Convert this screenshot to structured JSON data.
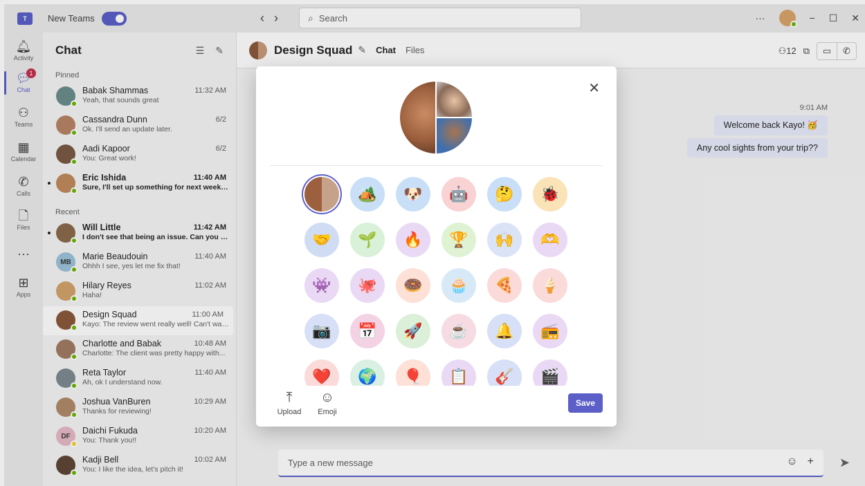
{
  "titlebar": {
    "app_label": "New Teams",
    "search_placeholder": "Search",
    "more": "···",
    "minimize": "−",
    "maximize": "☐",
    "close": "✕"
  },
  "rail": {
    "items": [
      {
        "label": "Activity",
        "icon": "bell-icon",
        "glyph": "🔔︎"
      },
      {
        "label": "Chat",
        "icon": "chat-icon",
        "glyph": "💬︎",
        "badge": "1"
      },
      {
        "label": "Teams",
        "icon": "teams-icon",
        "glyph": "⚇"
      },
      {
        "label": "Calendar",
        "icon": "calendar-icon",
        "glyph": "▦"
      },
      {
        "label": "Calls",
        "icon": "phone-icon",
        "glyph": "✆"
      },
      {
        "label": "Files",
        "icon": "file-icon",
        "glyph": "🗋︎"
      },
      {
        "label": "",
        "icon": "more-icon",
        "glyph": "···"
      },
      {
        "label": "Apps",
        "icon": "apps-icon",
        "glyph": "⊞"
      }
    ]
  },
  "chatlist": {
    "title": "Chat",
    "pinned_label": "Pinned",
    "recent_label": "Recent",
    "pinned": [
      {
        "name": "Babak Shammas",
        "preview": "Yeah, that sounds great",
        "time": "11:32 AM",
        "unread": false,
        "color": "#6b8e8c"
      },
      {
        "name": "Cassandra Dunn",
        "preview": "Ok. I'll send an update later.",
        "time": "6/2",
        "unread": false,
        "color": "#b88466"
      },
      {
        "name": "Aadi Kapoor",
        "preview": "You: Great work!",
        "time": "6/2",
        "unread": false,
        "color": "#7a5a44"
      },
      {
        "name": "Eric Ishida",
        "preview": "Sure, I'll set up something for next week t...",
        "time": "11:40 AM",
        "unread": true,
        "color": "#c08a5e"
      }
    ],
    "recent": [
      {
        "name": "Will Little",
        "preview": "I don't see that being an issue. Can you ta...",
        "time": "11:42 AM",
        "unread": true,
        "color": "#8a6a4c",
        "initials": ""
      },
      {
        "name": "Marie Beaudouin",
        "preview": "Ohhh I see, yes let me fix that!",
        "time": "11:40 AM",
        "unread": false,
        "color": "#9cc3d9",
        "initials": "MB"
      },
      {
        "name": "Hilary Reyes",
        "preview": "Haha!",
        "time": "11:02 AM",
        "unread": false,
        "color": "#d3a36b",
        "initials": ""
      },
      {
        "name": "Design Squad",
        "preview": "Kayo: The review went really well! Can't wai...",
        "time": "11:00 AM",
        "unread": false,
        "color": "#8a5a3c",
        "initials": "",
        "selected": true
      },
      {
        "name": "Charlotte and Babak",
        "preview": "Charlotte: The client was pretty happy with...",
        "time": "10:48 AM",
        "unread": false,
        "color": "#a07b62",
        "initials": ""
      },
      {
        "name": "Reta Taylor",
        "preview": "Ah, ok I understand now.",
        "time": "11:40 AM",
        "unread": false,
        "color": "#7d8a91",
        "initials": ""
      },
      {
        "name": "Joshua VanBuren",
        "preview": "Thanks for reviewing!",
        "time": "10:29 AM",
        "unread": false,
        "color": "#b08a6a",
        "initials": ""
      },
      {
        "name": "Daichi Fukuda",
        "preview": "You: Thank you!!",
        "time": "10:20 AM",
        "unread": false,
        "color": "#e7b9c6",
        "initials": "DF",
        "away": true
      },
      {
        "name": "Kadji Bell",
        "preview": "You: I like the idea, let's pitch it!",
        "time": "10:02 AM",
        "unread": false,
        "color": "#5e4636",
        "initials": ""
      }
    ]
  },
  "main": {
    "title": "Design Squad",
    "tabs": [
      "Chat",
      "Files"
    ],
    "participants": "12",
    "msg_time": "9:01 AM",
    "messages": [
      "Welcome back Kayo! 🥳",
      "Any cool sights from your trip??"
    ],
    "compose_placeholder": "Type a new message"
  },
  "dialog": {
    "close": "✕",
    "upload_label": "Upload",
    "emoji_label": "Emoji",
    "save_label": "Save",
    "options": [
      {
        "name": "group-photo-option",
        "emoji": "",
        "bg": "#f0f0f0"
      },
      {
        "name": "camping-tent-option",
        "emoji": "🏕️",
        "bg": "#c9dff7"
      },
      {
        "name": "dog-option",
        "emoji": "🐶",
        "bg": "#c9dff7"
      },
      {
        "name": "robot-option",
        "emoji": "🤖",
        "bg": "#f9d3d3"
      },
      {
        "name": "thinking-face-option",
        "emoji": "🤔",
        "bg": "#c9dff7"
      },
      {
        "name": "beetle-option",
        "emoji": "🐞",
        "bg": "#fbe3b8"
      },
      {
        "name": "handshake-option",
        "emoji": "🤝",
        "bg": "#cfdcf3"
      },
      {
        "name": "plant-hand-option",
        "emoji": "🌱",
        "bg": "#d9f0d9"
      },
      {
        "name": "flame-hands-option",
        "emoji": "🔥",
        "bg": "#ead9f5"
      },
      {
        "name": "trophy-option",
        "emoji": "🏆",
        "bg": "#dff3d4"
      },
      {
        "name": "hands-together-option",
        "emoji": "🙌",
        "bg": "#dbe3f7"
      },
      {
        "name": "heart-hands-option",
        "emoji": "🫶",
        "bg": "#ead9f5"
      },
      {
        "name": "purple-monster-option",
        "emoji": "👾",
        "bg": "#ead9f5"
      },
      {
        "name": "octopus-option",
        "emoji": "🐙",
        "bg": "#ead9f5"
      },
      {
        "name": "chef-donut-option",
        "emoji": "🍩",
        "bg": "#fde0d6"
      },
      {
        "name": "cupcake-option",
        "emoji": "🧁",
        "bg": "#d7e9f7"
      },
      {
        "name": "pizza-creature-option",
        "emoji": "🍕",
        "bg": "#fbdada"
      },
      {
        "name": "ice-cream-option",
        "emoji": "🍦",
        "bg": "#fbdada"
      },
      {
        "name": "camera-option",
        "emoji": "📷",
        "bg": "#d7e0f7"
      },
      {
        "name": "calendar-option",
        "emoji": "📅",
        "bg": "#f3d3e3"
      },
      {
        "name": "rocket-option",
        "emoji": "🚀",
        "bg": "#dbefd9"
      },
      {
        "name": "teacup-option",
        "emoji": "☕",
        "bg": "#f7dbe3"
      },
      {
        "name": "bell-option",
        "emoji": "🔔",
        "bg": "#d7e0f7"
      },
      {
        "name": "boombox-option",
        "emoji": "📻",
        "bg": "#ead9f5"
      },
      {
        "name": "heart-option",
        "emoji": "❤️",
        "bg": "#fbdada"
      },
      {
        "name": "globe-option",
        "emoji": "🌍",
        "bg": "#d9f0e3"
      },
      {
        "name": "balloon-option",
        "emoji": "🎈",
        "bg": "#fde0d6"
      },
      {
        "name": "board-option",
        "emoji": "📋",
        "bg": "#ead9f5"
      },
      {
        "name": "guitar-option",
        "emoji": "🎸",
        "bg": "#d7e0f7"
      },
      {
        "name": "video-option",
        "emoji": "🎬",
        "bg": "#ead9f5"
      }
    ]
  },
  "colors": {
    "accent": "#5b5fc7",
    "online": "#6bb700",
    "away": "#f8d22a",
    "badge": "#c4314b"
  }
}
